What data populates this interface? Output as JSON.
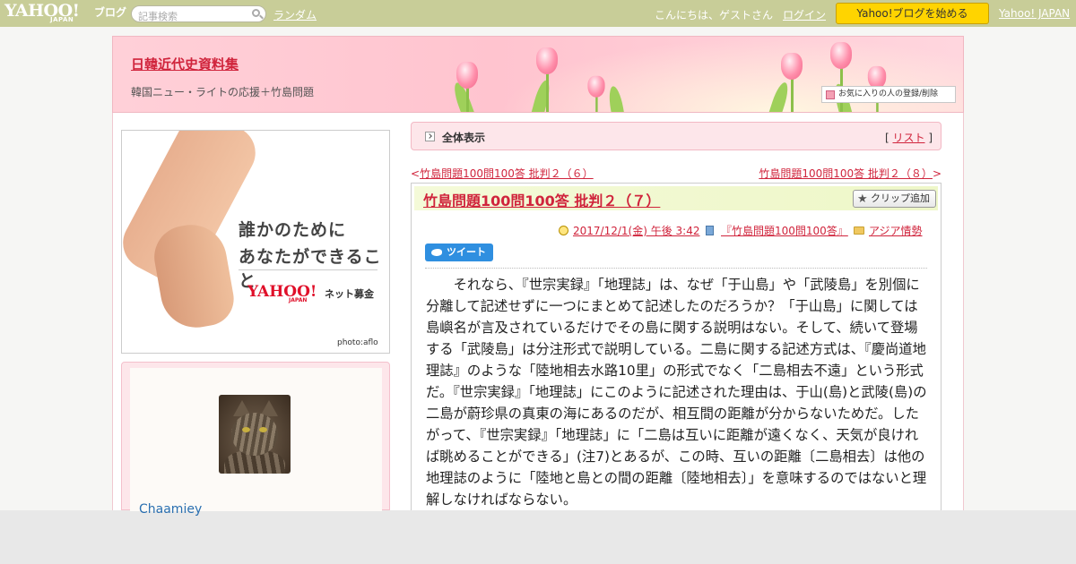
{
  "topbar": {
    "logo_yahoo": "YAHOO!",
    "logo_japan": "JAPAN",
    "logo_blog": "ブログ",
    "search_placeholder": "記事検索",
    "random": "ランダム",
    "greeting": "こんにちは、ゲストさん",
    "login": "ログイン",
    "start_blog": "Yahoo!ブログを始める",
    "yahoo_japan": "Yahoo! JAPAN"
  },
  "header": {
    "title": "日韓近代史資料集",
    "subtitle": "韓国ニュー・ライトの応援＋竹島問題",
    "favorite_button": "お気に入りの人の登録/削除"
  },
  "ad": {
    "line1": "誰かのために",
    "line2": "あなたができること",
    "logo": "YAHOO!",
    "logo_japan": "JAPAN",
    "service": "ネット募金",
    "credit": "photo:aflo"
  },
  "profile": {
    "username": "Chaamiey"
  },
  "allview": {
    "label": "全体表示",
    "list_open": "[ ",
    "list_link": "リスト",
    "list_close": " ]"
  },
  "nav": {
    "prev_arrow": "<",
    "prev_title": "竹島問題100問100答 批判２（６）",
    "next_title": "竹島問題100問100答 批判２（８）",
    "next_arrow": ">"
  },
  "article": {
    "title": "竹島問題100問100答 批判２（７）",
    "clip_button": "クリップ追加",
    "date": "2017/12/1(金) 午後 3:42",
    "book": "『竹島問題100問100答』",
    "category": "アジア情勢",
    "tweet": "ツイート",
    "body": "それなら、『世宗実録』「地理誌」は、なぜ「于山島」や「武陵島」を別個に分離して記述せずに一つにまとめて記述したのだろうか？「于山島」に関しては島嶼名が言及されているだけでその島に関する説明はない。そして、続いて登場する「武陵島」は分注形式で説明している。二島に関する記述方式は、『慶尚道地理誌』のような「陸地相去水路10里」の形式でなく「二島相去不遠」という形式だ。『世宗実録』「地理誌」にこのように記述された理由は、于山(島)と武陵(島)の二島が蔚珍県の真東の海にあるのだが、相互間の距離が分からないためだ。したがって、『世宗実録』「地理誌」に「二島は互いに距離が遠くなく、天気が良ければ眺めることができる」(注7)とあるが、この時、互いの距離〔二島相去〕は他の地理誌のように「陸地と島との間の距離〔陸地相去〕」を意味するのではないと理解しなければならない。"
  },
  "colors": {
    "topbar": "#c8cd98",
    "accent": "#d0243c",
    "start_button": "#ffd400",
    "link_blue": "#2a6fb0"
  }
}
